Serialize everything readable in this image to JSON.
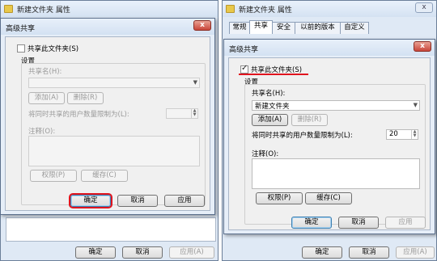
{
  "left": {
    "window_title": "新建文件夹 属性",
    "dialog_title": "高级共享",
    "share_checkbox": "共享此文件夹(S)",
    "share_checked": false,
    "settings_label": "设置",
    "share_name_label": "共享名(H):",
    "share_name_value": "",
    "add_button": "添加(A)",
    "remove_button": "删除(R)",
    "limit_label": "将同时共享的用户数量限制为(L):",
    "limit_value": "",
    "comment_label": "注释(O):",
    "permissions_button": "权限(P)",
    "cache_button": "缓存(C)",
    "ok_button": "确定",
    "cancel_button": "取消",
    "apply_button": "应用",
    "parent_ok": "确定",
    "parent_cancel": "取消",
    "parent_apply": "应用(A)"
  },
  "right": {
    "window_title": "新建文件夹 属性",
    "tabs": [
      "常规",
      "共享",
      "安全",
      "以前的版本",
      "自定义"
    ],
    "dialog_title": "高级共享",
    "share_checkbox": "共享此文件夹(S)",
    "share_checked": true,
    "settings_label": "设置",
    "share_name_label": "共享名(H):",
    "share_name_value": "新建文件夹",
    "add_button": "添加(A)",
    "remove_button": "删除(R)",
    "limit_label": "将同时共享的用户数量限制为(L):",
    "limit_value": "20",
    "comment_label": "注释(O):",
    "permissions_button": "权限(P)",
    "cache_button": "缓存(C)",
    "ok_button": "确定",
    "cancel_button": "取消",
    "apply_button": "应用",
    "parent_ok": "确定",
    "parent_cancel": "取消",
    "parent_apply": "应用(A)"
  },
  "colors": {
    "highlight": "#e0141e",
    "title_bg": "#dfe9f5",
    "close": "#c8453a"
  },
  "icons": {
    "title": "folder-icon",
    "close": "close-icon",
    "dropdown": "chevron-down-icon"
  }
}
